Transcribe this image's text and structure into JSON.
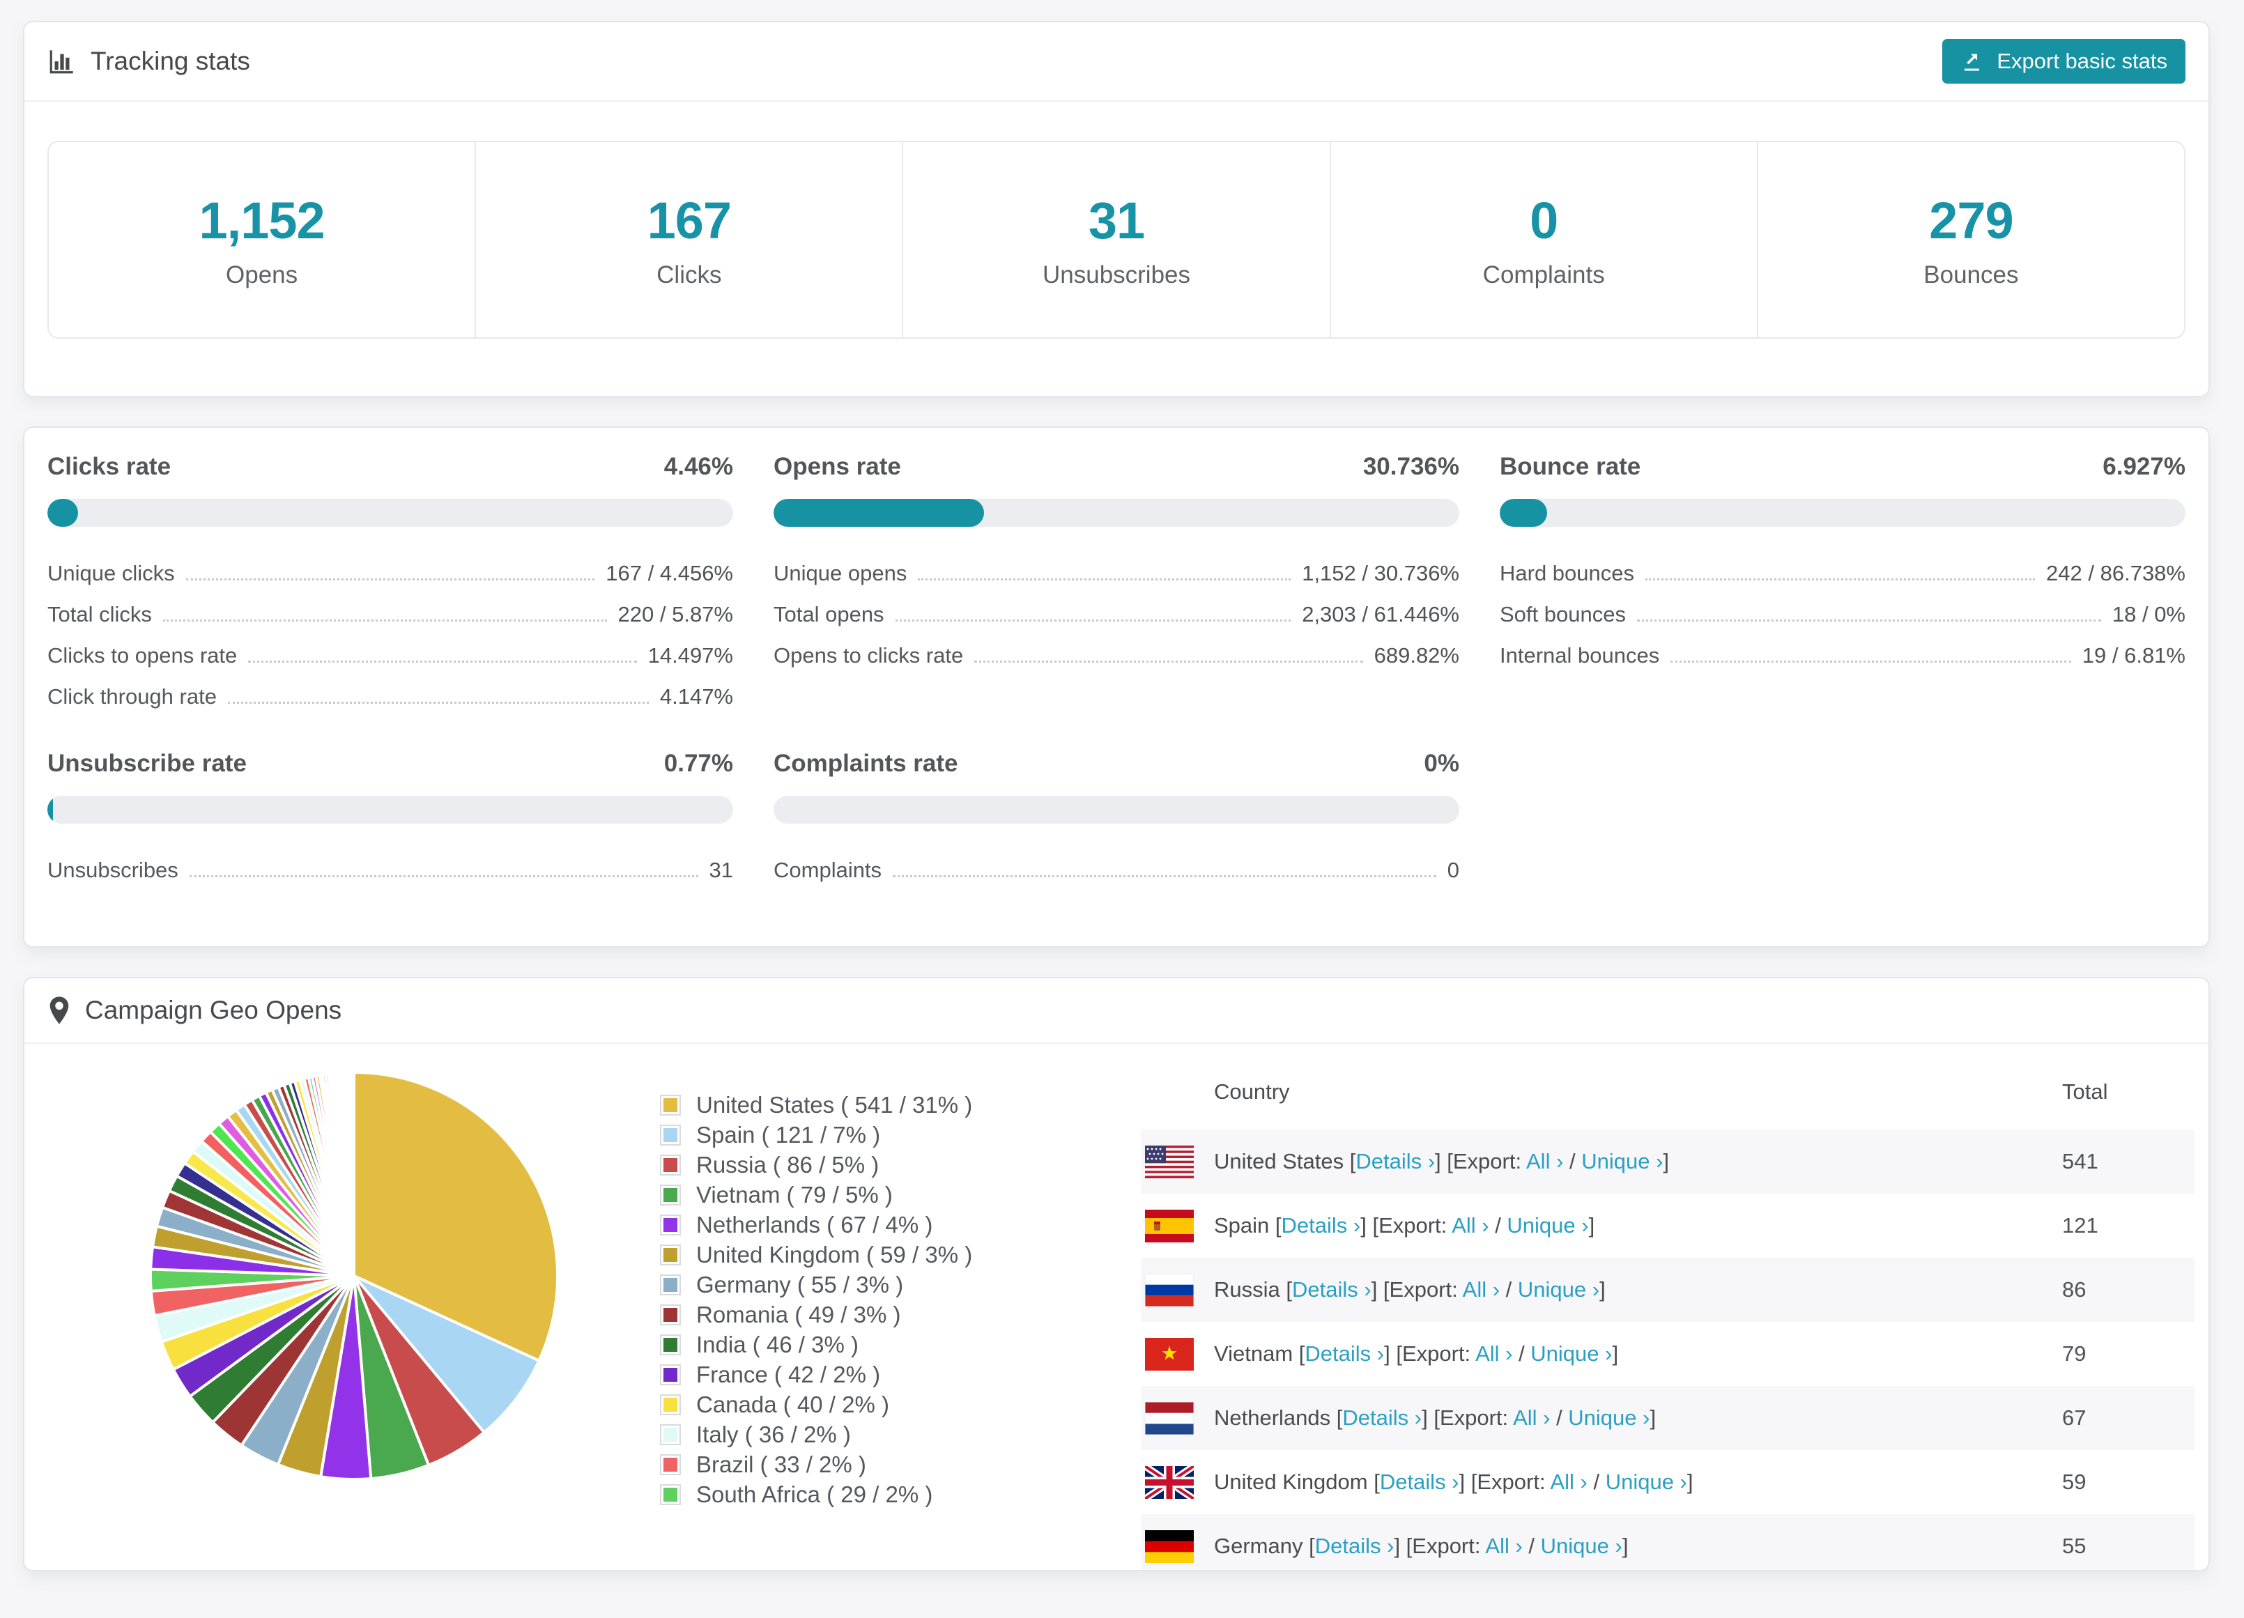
{
  "accent": {
    "teal": "#1692a3",
    "link_blue": "#2b9fc2",
    "track_gray": "#ebedf0",
    "stat_number_teal": "#1792a6"
  },
  "tracking": {
    "title": "Tracking stats",
    "export_button_label": "Export basic stats",
    "stats": [
      {
        "value": "1,152",
        "label": "Opens"
      },
      {
        "value": "167",
        "label": "Clicks"
      },
      {
        "value": "31",
        "label": "Unsubscribes"
      },
      {
        "value": "0",
        "label": "Complaints"
      },
      {
        "value": "279",
        "label": "Bounces"
      }
    ]
  },
  "rates": {
    "sections": [
      {
        "title": "Clicks rate",
        "value": "4.46%",
        "percent": 4.46,
        "rows": [
          {
            "label": "Unique clicks",
            "value": "167 / 4.456%"
          },
          {
            "label": "Total clicks",
            "value": "220 / 5.87%"
          },
          {
            "label": "Clicks to opens rate",
            "value": "14.497%"
          },
          {
            "label": "Click through rate",
            "value": "4.147%"
          }
        ]
      },
      {
        "title": "Opens rate",
        "value": "30.736%",
        "percent": 30.736,
        "rows": [
          {
            "label": "Unique opens",
            "value": "1,152 / 30.736%"
          },
          {
            "label": "Total opens",
            "value": "2,303 / 61.446%"
          },
          {
            "label": "Opens to clicks rate",
            "value": "689.82%"
          }
        ]
      },
      {
        "title": "Bounce rate",
        "value": "6.927%",
        "percent": 6.927,
        "rows": [
          {
            "label": "Hard bounces",
            "value": "242 / 86.738%"
          },
          {
            "label": "Soft bounces",
            "value": "18 / 0%"
          },
          {
            "label": "Internal bounces",
            "value": "19 / 6.81%"
          }
        ]
      },
      {
        "title": "Unsubscribe rate",
        "value": "0.77%",
        "percent": 0.77,
        "rows": [
          {
            "label": "Unsubscribes",
            "value": "31"
          }
        ]
      },
      {
        "title": "Complaints rate",
        "value": "0%",
        "percent": 0,
        "rows": [
          {
            "label": "Complaints",
            "value": "0"
          }
        ]
      }
    ]
  },
  "geo": {
    "title": "Campaign Geo Opens",
    "table": {
      "headers": [
        "Country",
        "Total"
      ],
      "link_labels": {
        "details": "Details ›",
        "export_prefix": "Export:",
        "all": "All ›",
        "unique": "Unique ›"
      },
      "rows": [
        {
          "country": "United States",
          "total": "541",
          "flag": "us"
        },
        {
          "country": "Spain",
          "total": "121",
          "flag": "es"
        },
        {
          "country": "Russia",
          "total": "86",
          "flag": "ru"
        },
        {
          "country": "Vietnam",
          "total": "79",
          "flag": "vn"
        },
        {
          "country": "Netherlands",
          "total": "67",
          "flag": "nl"
        },
        {
          "country": "United Kingdom",
          "total": "59",
          "flag": "gb"
        },
        {
          "country": "Germany",
          "total": "55",
          "flag": "de"
        }
      ]
    }
  },
  "chart_data": {
    "type": "pie",
    "title": "Campaign Geo Opens",
    "start_angle_deg": -90,
    "direction": "clockwise",
    "legend_position": "right",
    "series": [
      {
        "name": "United States",
        "value": 541,
        "pct": "31%",
        "color": "#e3bd41"
      },
      {
        "name": "Spain",
        "value": 121,
        "pct": "7%",
        "color": "#a9d6f2"
      },
      {
        "name": "Russia",
        "value": 86,
        "pct": "5%",
        "color": "#c94c4c"
      },
      {
        "name": "Vietnam",
        "value": 79,
        "pct": "5%",
        "color": "#4aa84f"
      },
      {
        "name": "Netherlands",
        "value": 67,
        "pct": "4%",
        "color": "#9233ea"
      },
      {
        "name": "United Kingdom",
        "value": 59,
        "pct": "3%",
        "color": "#bfa02e"
      },
      {
        "name": "Germany",
        "value": 55,
        "pct": "3%",
        "color": "#8cafc9"
      },
      {
        "name": "Romania",
        "value": 49,
        "pct": "3%",
        "color": "#9e3535"
      },
      {
        "name": "India",
        "value": 46,
        "pct": "3%",
        "color": "#2e7d33"
      },
      {
        "name": "France",
        "value": 42,
        "pct": "2%",
        "color": "#7229c9"
      },
      {
        "name": "Canada",
        "value": 40,
        "pct": "2%",
        "color": "#f8e13e"
      },
      {
        "name": "Italy",
        "value": 36,
        "pct": "2%",
        "color": "#dffaf7"
      },
      {
        "name": "Brazil",
        "value": 33,
        "pct": "2%",
        "color": "#f16363"
      },
      {
        "name": "South Africa",
        "value": 29,
        "pct": "2%",
        "color": "#5dd05d"
      }
    ],
    "unlabeled_small_slices": [
      30,
      28,
      26,
      24,
      22,
      20,
      19,
      18,
      17,
      16,
      15,
      14,
      13,
      12,
      11,
      10,
      9,
      9,
      8,
      8,
      7,
      7,
      6,
      6,
      5,
      5,
      5,
      4,
      4,
      4,
      3,
      3,
      3,
      3,
      2,
      2,
      2,
      2,
      2,
      2,
      1,
      1,
      1,
      1,
      1,
      1,
      1,
      1,
      1,
      1
    ],
    "small_slice_palette": [
      "#8b2fe8",
      "#bfa02e",
      "#8cafc9",
      "#a03535",
      "#2e7d33",
      "#35308f",
      "#f9e84a",
      "#dcfbf8",
      "#f26060",
      "#4ee84e",
      "#e05ce0",
      "#e4bf3f",
      "#a8d8f0",
      "#c94c4c",
      "#46a64b"
    ]
  }
}
